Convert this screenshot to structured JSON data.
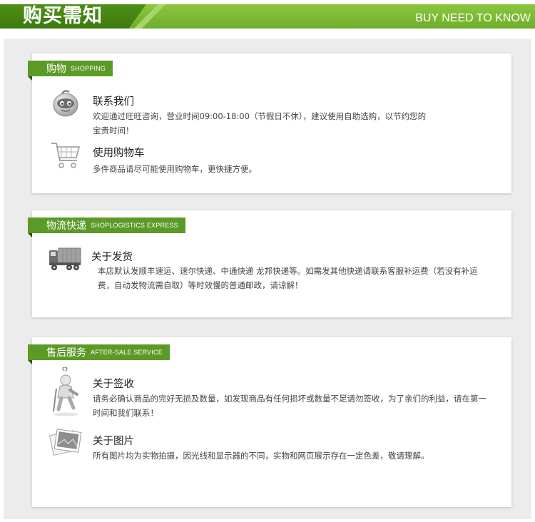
{
  "header": {
    "title": "购买需知",
    "subtitle": "BUY NEED TO KNOW"
  },
  "sections": [
    {
      "tab_cn": "购物",
      "tab_en": "SHOPPING",
      "items": [
        {
          "icon": "wangwang-chat-icon",
          "title": "联系我们",
          "desc_line1": "欢迎通过旺旺咨询，营业时间09:00-18:00（节假日不休），建议使用自助选购，以节约您的",
          "desc_line2": "宝贵时间！"
        },
        {
          "icon": "shopping-cart-icon",
          "title": "使用购物车",
          "desc_line1": "多件商品请尽可能使用购物车，更快捷方便。"
        }
      ]
    },
    {
      "tab_cn": "物流快递",
      "tab_en": "SHOPLOGISTICS EXPRESS",
      "items": [
        {
          "icon": "delivery-truck-icon",
          "title": "关于发货",
          "desc_line1": "本店默认发顺丰速运、速尔快递、中通快递 龙邦快递等。如需发其他快递请联系客服补运费（若没有补运",
          "desc_line2": "费，自动发物流需自取）等时效慢的普通邮政，请谅解！"
        }
      ]
    },
    {
      "tab_cn": "售后服务",
      "tab_en": "AFTER-SALE SERVICE",
      "items": [
        {
          "icon": "signing-person-icon",
          "title": "关于签收",
          "desc_line1": "请务必确认商品的完好无损及数量，如发现商品有任何损坏或数量不足请勿签收，为了亲们的利益，请在第一",
          "desc_line2": "时间和我们联系！"
        },
        {
          "icon": "photo-icon",
          "title": "关于图片",
          "desc_line1": "所有图片均为实物拍摄，因光线和显示器的不同，实物和网页展示存在一定色差，敬请理解。"
        }
      ]
    }
  ]
}
